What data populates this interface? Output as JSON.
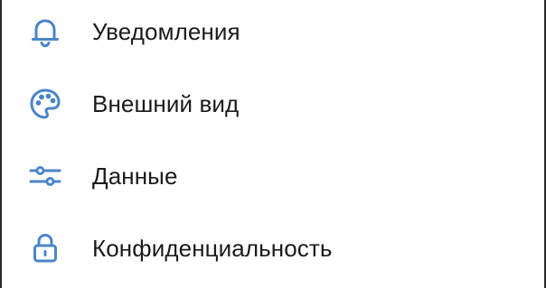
{
  "theme": {
    "accent_color": "#4a86c8",
    "text_color": "#1b1b1b"
  },
  "settings": {
    "items": [
      {
        "label": "Уведомления",
        "icon": "bell-icon"
      },
      {
        "label": "Внешний вид",
        "icon": "palette-icon"
      },
      {
        "label": "Данные",
        "icon": "sliders-icon"
      },
      {
        "label": "Конфиденциальность",
        "icon": "lock-icon"
      }
    ]
  }
}
